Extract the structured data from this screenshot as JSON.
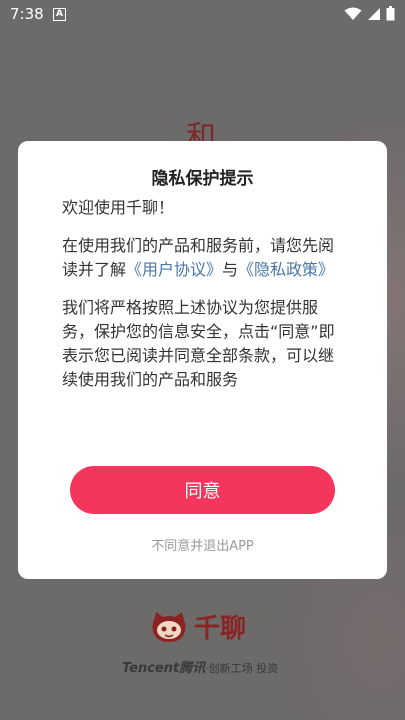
{
  "status_bar": {
    "time": "7:38",
    "notification_glyph": "A",
    "icons": [
      "wifi-icon",
      "signal-icon",
      "battery-icon"
    ]
  },
  "background": {
    "glyph": "和"
  },
  "dialog": {
    "title": "隐私保护提示",
    "welcome": "欢迎使用千聊！",
    "para1_prefix": "在使用我们的产品和服务前，请您先阅读并了解",
    "user_agreement_link": "《用户协议》",
    "para1_and": "与",
    "privacy_policy_link": "《隐私政策》",
    "para2": "我们将严格按照上述协议为您提供服务，保护您的信息安全，点击“同意”即表示您已阅读并同意全部条款，可以继续使用我们的产品和服务",
    "agree_label": "同意",
    "disagree_label": "不同意并退出APP"
  },
  "footer": {
    "brand_name": "千聊",
    "tencent": "Tencent",
    "tencent_cn": "腾讯",
    "tagline_rest": "·创新工场 投资"
  },
  "colors": {
    "accent": "#f5365c",
    "link": "#4a78a6",
    "brand": "#8c2323"
  }
}
